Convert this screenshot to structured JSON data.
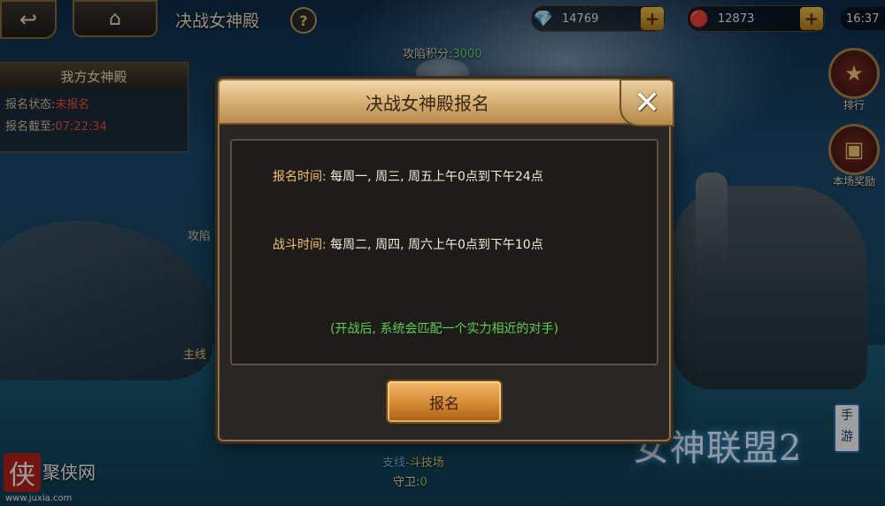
{
  "header": {
    "back_label": "↩",
    "home_icon": "⌂",
    "title": "决战女神殿",
    "help_label": "?"
  },
  "resources": {
    "gems": {
      "icon": "diamond-icon",
      "value": "14769",
      "add": "+"
    },
    "rubies": {
      "icon": "ruby-icon",
      "value": "12873",
      "add": "+"
    },
    "clock": "16:37"
  },
  "score": {
    "label": "攻陷积分:",
    "value": "3000"
  },
  "left_panel": {
    "title": "我方女神殿",
    "status_label": "报名状态:",
    "status_value": "未报名",
    "deadline_label": "报名截至:",
    "deadline_value": "07:22:34",
    "side_label": "攻陷",
    "lane_label": "主线"
  },
  "right_menu": {
    "rank_label": "排行",
    "reward_label": "本场奖励"
  },
  "bottom": {
    "sub_prefix": "支线",
    "sub_name": "斗技场",
    "guard_label": "守卫:",
    "guard_value": "0"
  },
  "logos": {
    "left_seal": "侠",
    "left_brand": "聚侠网",
    "left_url": "www.juxia.com",
    "right_main": "女神联盟2",
    "right_sub": "手游"
  },
  "modal": {
    "title": "决战女神殿报名",
    "close_label": "✕",
    "signup_time_label": "报名时间:",
    "signup_time_value": "每周一, 周三, 周五上午0点到下午24点",
    "battle_time_label": "战斗时间:",
    "battle_time_value": "每周二, 周四, 周六上午0点到下午10点",
    "note": "(开战后, 系统会匹配一个实力相近的对手)",
    "signup_button": "报名"
  },
  "colors": {
    "accent_gold": "#efc36e",
    "note_green": "#5ad24a",
    "status_red": "#ff4a3a",
    "score_green": "#6ee26e"
  }
}
